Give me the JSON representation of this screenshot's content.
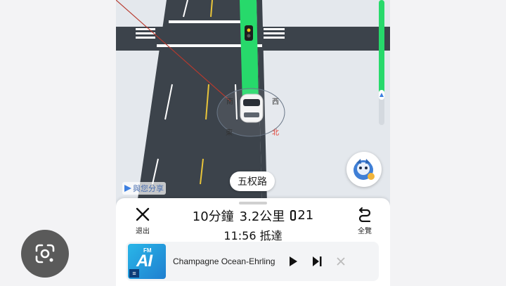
{
  "map": {
    "road_name": "五权路",
    "compass": {
      "south": "南",
      "west": "西",
      "east": "東",
      "north": "北"
    },
    "share_label": "與您分享",
    "route_progress": 0.75
  },
  "trip": {
    "duration": "10分鐘",
    "distance": "3.2公里",
    "traffic_lights": "21",
    "arrival": "11:56 抵達"
  },
  "controls": {
    "exit_label": "退出",
    "overview_label": "全覽"
  },
  "media": {
    "cover_fm": "FM",
    "cover_ai": "AI",
    "track_title": "Champagne Ocean-Ehrling"
  },
  "colors": {
    "route_green": "#27d96b",
    "road_asphalt": "#3c434b",
    "compass_north": "#e23b2e"
  },
  "icons": {
    "exit": "close-icon",
    "overview": "route-overview-icon",
    "play": "play-icon",
    "next": "skip-next-icon",
    "dismiss": "close-icon",
    "lens": "google-lens-icon"
  }
}
